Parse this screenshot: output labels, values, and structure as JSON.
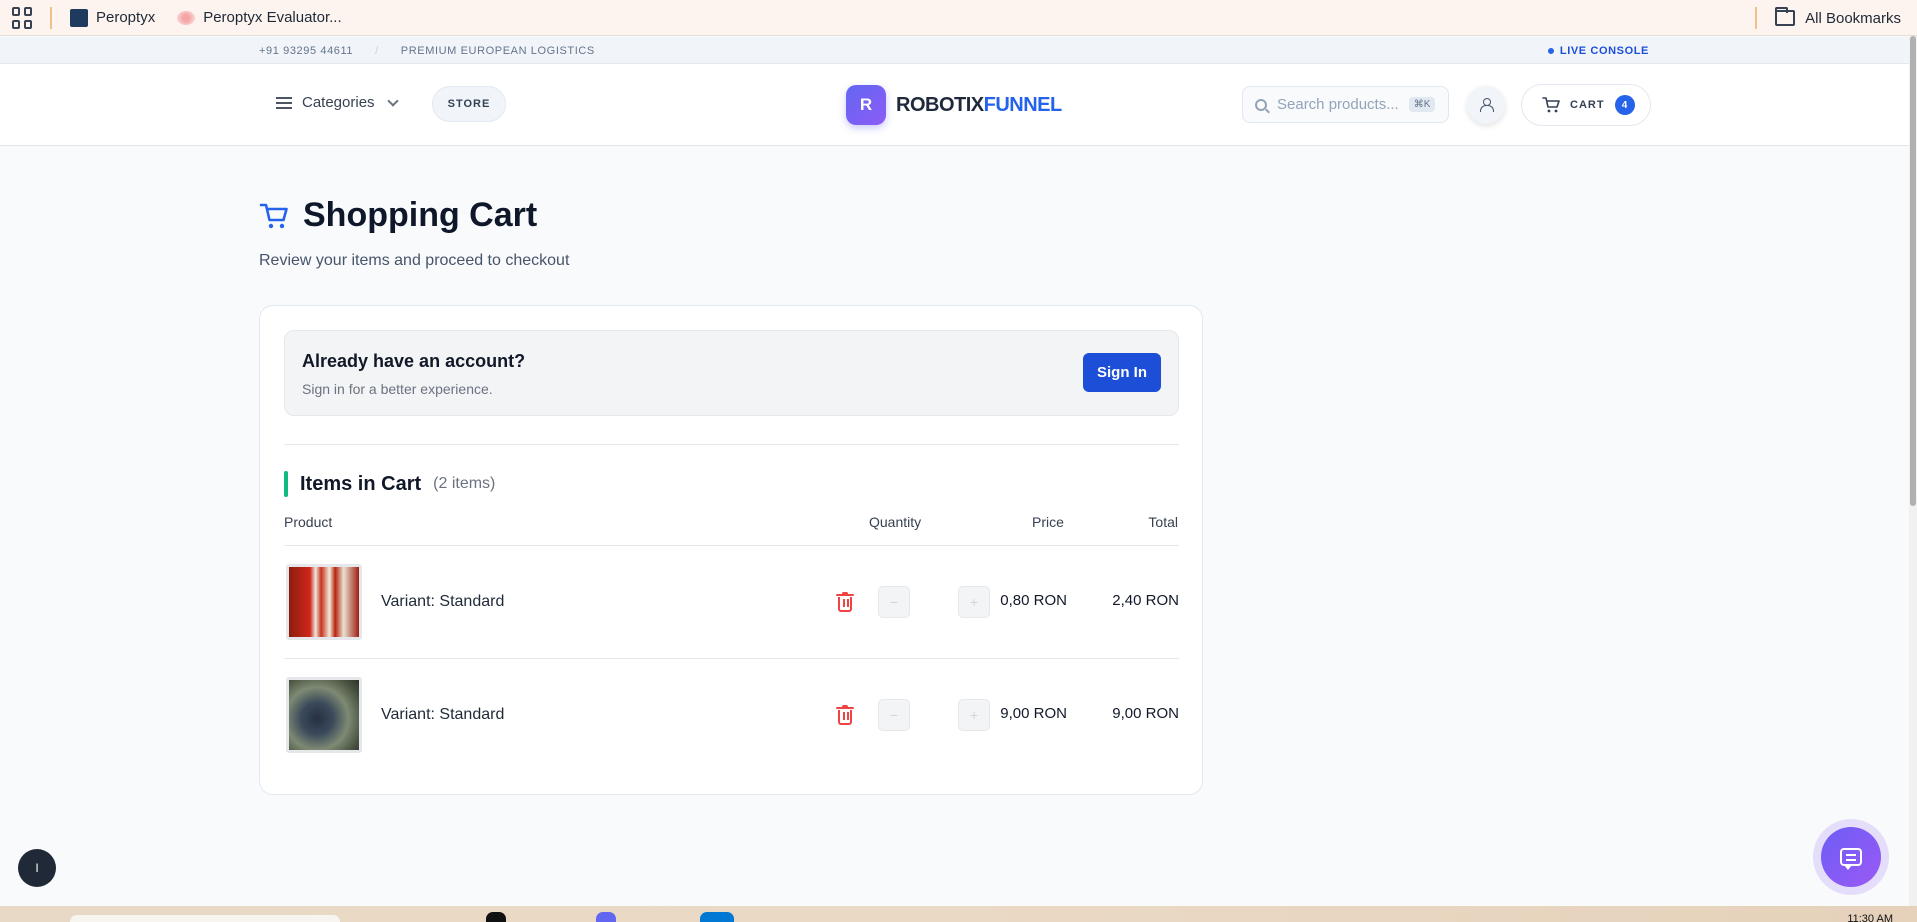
{
  "browser": {
    "bookmarks": [
      {
        "label": "Peroptyx"
      },
      {
        "label": "Peroptyx Evaluator..."
      }
    ],
    "all_bookmarks": "All Bookmarks"
  },
  "topbar": {
    "phone": "+91 93295 44611",
    "separator": "/",
    "tagline": "PREMIUM EUROPEAN LOGISTICS",
    "live": "LIVE CONSOLE"
  },
  "header": {
    "categories": "Categories",
    "store": "STORE",
    "logo_mark": "R",
    "logo_part1": "ROBOTIX",
    "logo_part2": "FUNNEL",
    "search_placeholder": "Search products...",
    "search_kbd": "⌘K",
    "cart_label": "CART",
    "cart_count": "4"
  },
  "page": {
    "title": "Shopping Cart",
    "subtitle": "Review your items and proceed to checkout"
  },
  "signin": {
    "title": "Already have an account?",
    "subtitle": "Sign in for a better experience.",
    "button": "Sign In"
  },
  "cart": {
    "heading": "Items in Cart",
    "count": "(2 items)",
    "columns": {
      "product": "Product",
      "quantity": "Quantity",
      "price": "Price",
      "total": "Total"
    },
    "items": [
      {
        "variant": "Variant: Standard",
        "quantity": "",
        "price": "0,80 RON",
        "total": "2,40 RON",
        "minus": "−",
        "plus": "+"
      },
      {
        "variant": "Variant: Standard",
        "quantity": "",
        "price": "9,00 RON",
        "total": "9,00 RON",
        "minus": "−",
        "plus": "+"
      }
    ]
  },
  "floating": {
    "left_button": "I"
  },
  "taskbar": {
    "clock": "11:30 AM"
  },
  "colors": {
    "accent_blue": "#2563eb",
    "brand_purple": "#7c3aed",
    "delete_red": "#ef4444",
    "section_accent": "#10b981"
  }
}
